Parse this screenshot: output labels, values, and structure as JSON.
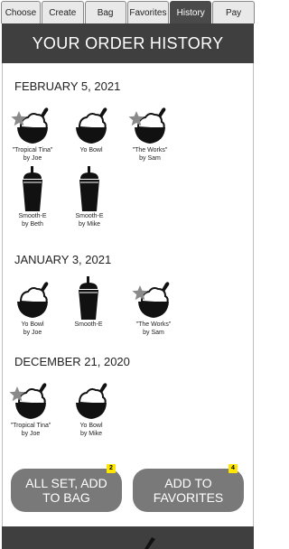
{
  "tabs": [
    {
      "label": "Choose"
    },
    {
      "label": "Create"
    },
    {
      "label": "Bag"
    },
    {
      "label": "Favorites"
    },
    {
      "label": "History"
    },
    {
      "label": "Pay"
    }
  ],
  "active_tab": "History",
  "header": {
    "title": "YOUR ORDER HISTORY"
  },
  "orders": [
    {
      "date": "FEBRUARY 5, 2021",
      "items": [
        {
          "type": "bowl",
          "favorite": true,
          "line1": "\"Tropical Tina\"",
          "line2": "by Joe"
        },
        {
          "type": "bowl",
          "favorite": false,
          "line1": "Yo Bowl",
          "line2": ""
        },
        {
          "type": "bowl",
          "favorite": true,
          "line1": "\"The Works\"",
          "line2": "by Sam"
        },
        {
          "type": "smoothie",
          "favorite": false,
          "line1": "Smooth-E",
          "line2": "by Beth"
        },
        {
          "type": "smoothie",
          "favorite": false,
          "line1": "Smooth-E",
          "line2": "by Mike"
        }
      ]
    },
    {
      "date": "JANUARY 3, 2021",
      "items": [
        {
          "type": "bowl",
          "favorite": false,
          "line1": "Yo Bowl",
          "line2": "by Joe"
        },
        {
          "type": "smoothie",
          "favorite": false,
          "line1": "Smooth-E",
          "line2": ""
        },
        {
          "type": "bowl",
          "favorite": true,
          "line1": "\"The Works\"",
          "line2": "by Sam"
        }
      ]
    },
    {
      "date": "DECEMBER 21, 2020",
      "items": [
        {
          "type": "bowl",
          "favorite": true,
          "line1": "\"Tropical Tina\"",
          "line2": "by Joe"
        },
        {
          "type": "bowl",
          "favorite": false,
          "line1": "Yo Bowl",
          "line2": "by Mike"
        }
      ]
    }
  ],
  "actions": {
    "add_to_bag": {
      "line1": "ALL SET, ADD",
      "line2": "TO BAG",
      "count": "2"
    },
    "add_to_favorites": {
      "line1": "ADD TO",
      "line2": "FAVORITES",
      "count": "4"
    }
  },
  "colors": {
    "header_bg": "#3f3f3f",
    "button_bg": "#797979",
    "badge": "#ffe600",
    "star": "#8a8a8a"
  }
}
